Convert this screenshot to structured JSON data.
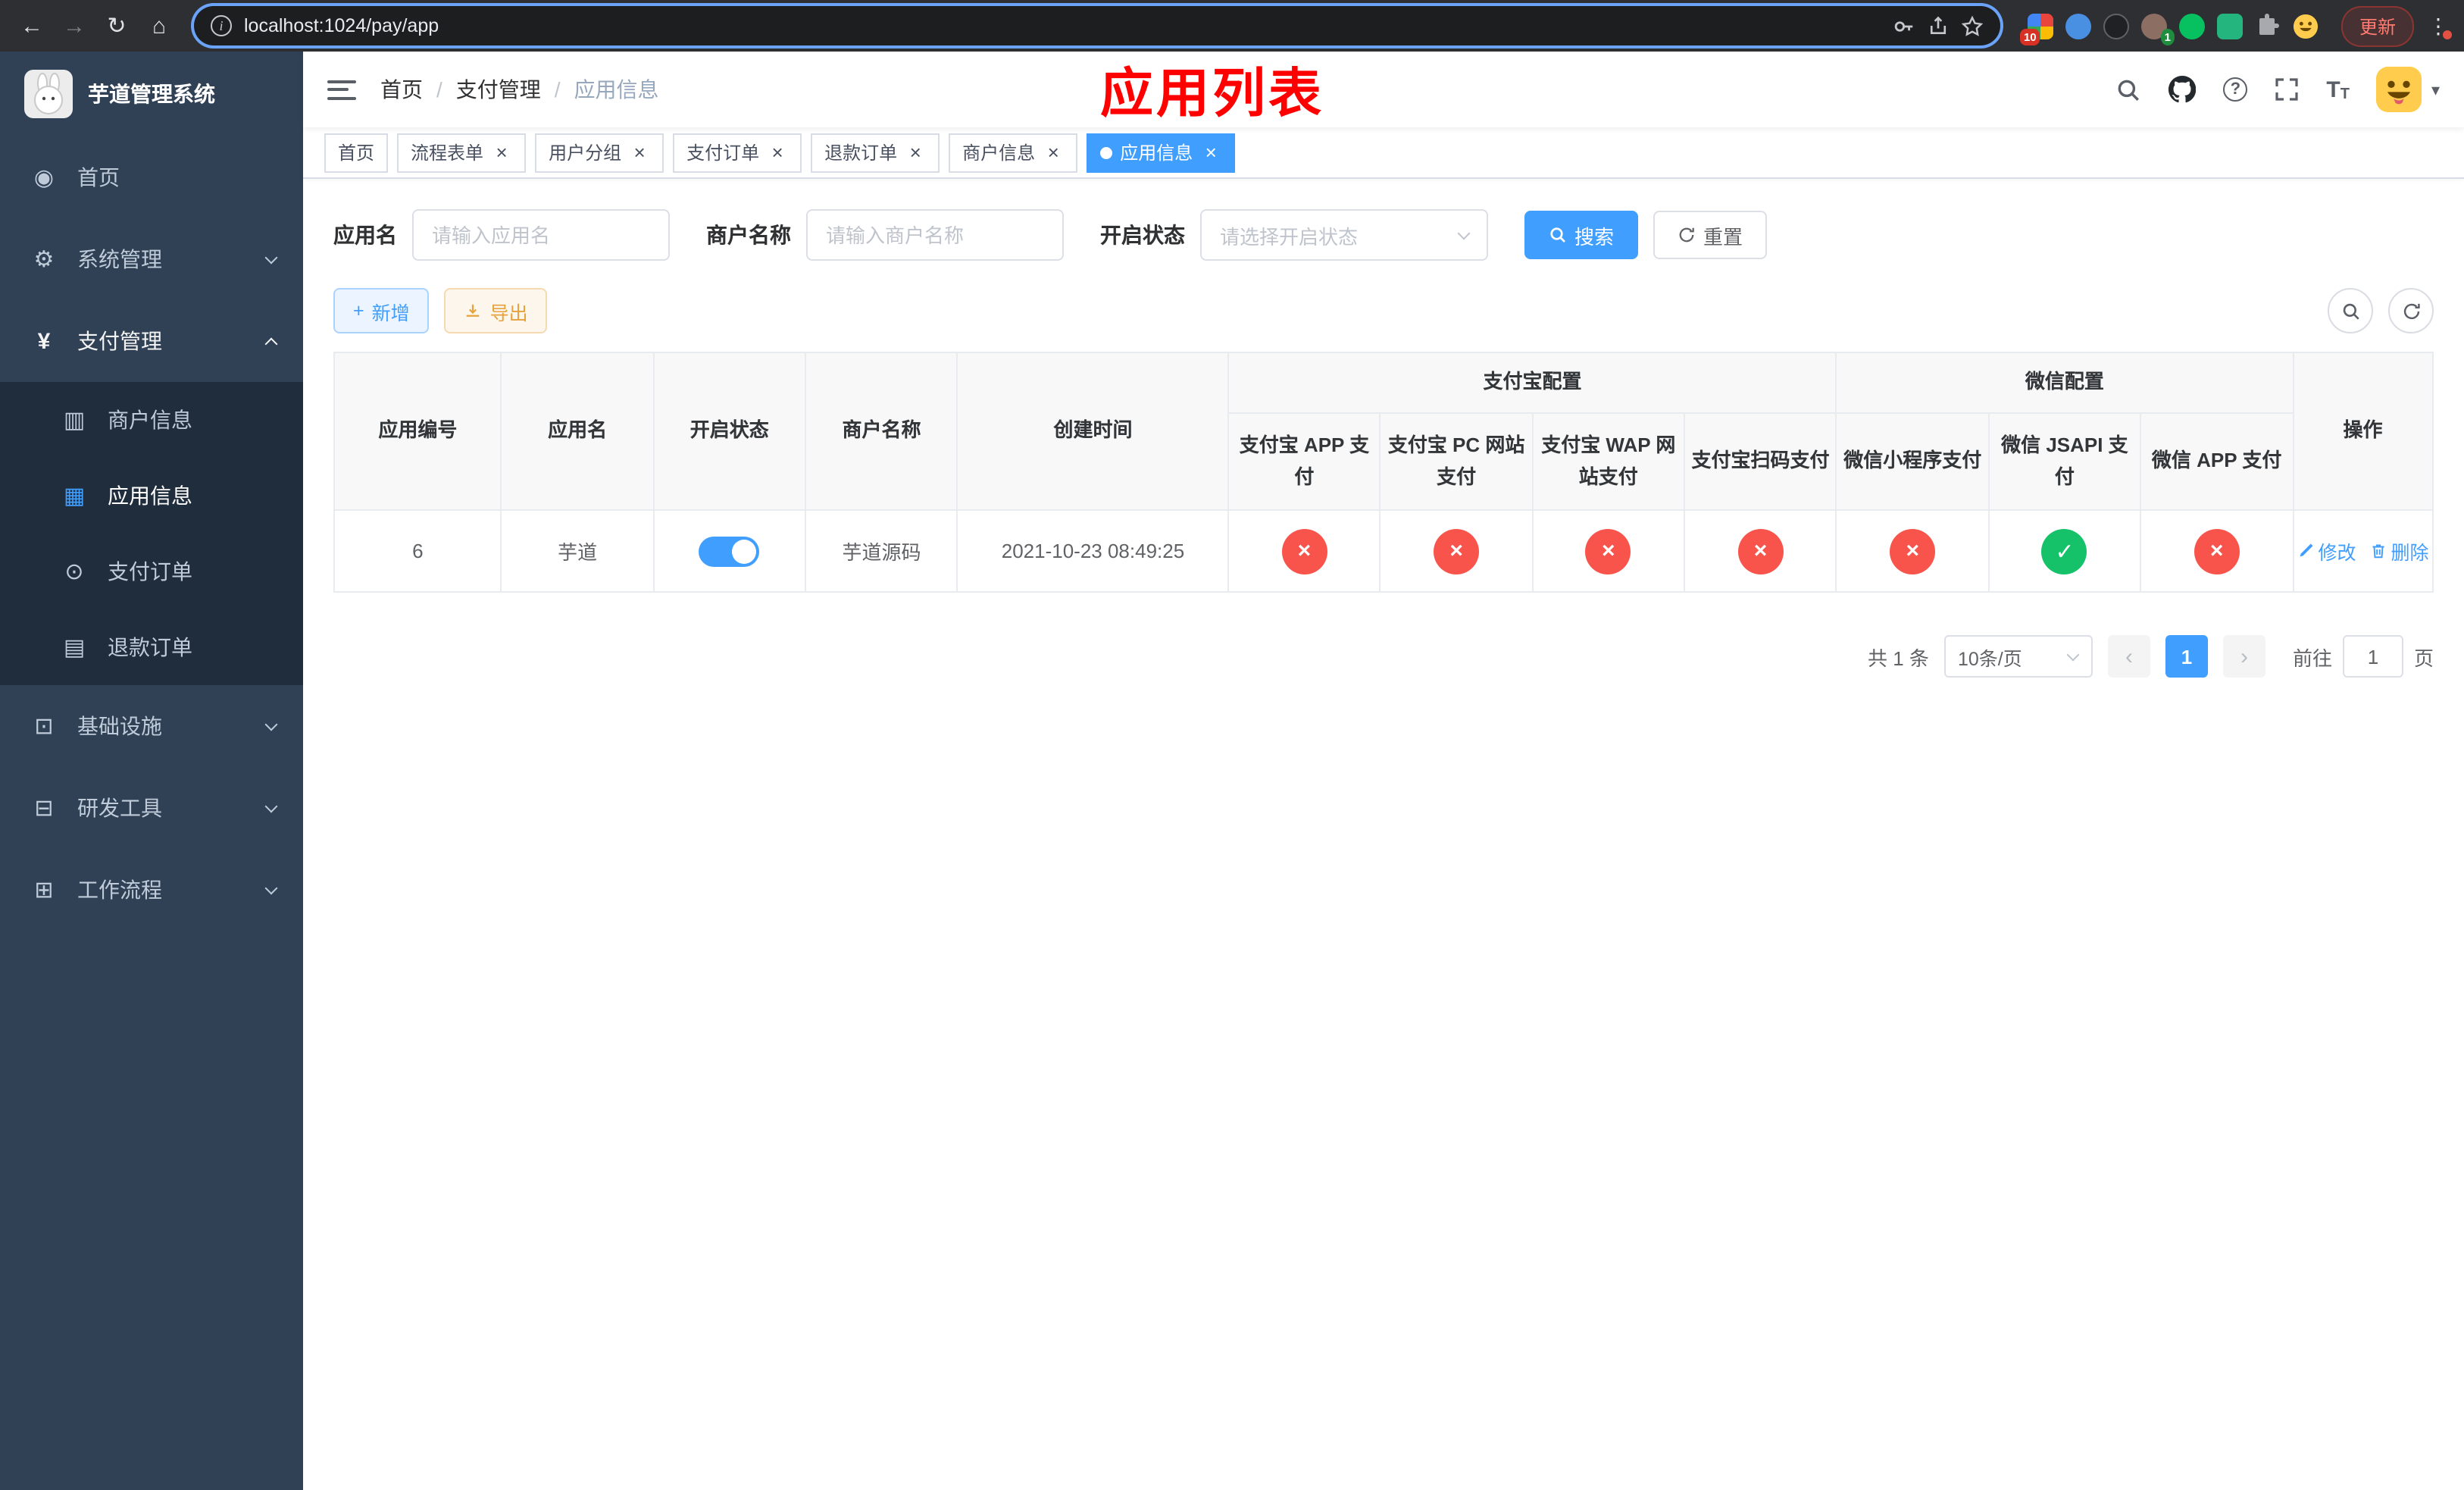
{
  "colors": {
    "primary": "#409eff",
    "danger": "#f8544b",
    "success": "#16c269",
    "warning": "#e6a23c",
    "annotation_red": "#fe0000",
    "sidebar_bg": "#304156",
    "submenu_bg": "#1f2d3d"
  },
  "icons": {
    "back": "←",
    "forward": "→",
    "reload": "↻",
    "home": "⌂",
    "kebab": "⋮",
    "caret_down": "▾",
    "close": "×",
    "check": "✓",
    "cross": "×",
    "dashboard": "◉",
    "gear": "⚙",
    "yen": "¥",
    "merchant_card": "▥",
    "app_grid": "▦",
    "pay_order": "⊙",
    "refund_doc": "▤",
    "infra": "⊡",
    "devtools": "⊟",
    "workflow": "⊞",
    "plus": "+"
  },
  "browser": {
    "url": "localhost:1024/pay/app",
    "update_label": "更新",
    "ext_badge_blocker": "10",
    "ext_badge_profile": "1"
  },
  "sidebar": {
    "title": "芋道管理系统",
    "menu": [
      {
        "label": "首页"
      },
      {
        "label": "系统管理"
      },
      {
        "label": "支付管理"
      },
      {
        "label": "基础设施"
      },
      {
        "label": "研发工具"
      },
      {
        "label": "工作流程"
      }
    ],
    "payment_children": [
      {
        "label": "商户信息"
      },
      {
        "label": "应用信息"
      },
      {
        "label": "支付订单"
      },
      {
        "label": "退款订单"
      }
    ]
  },
  "navbar": {
    "breadcrumb": [
      {
        "label": "首页"
      },
      {
        "label": "支付管理"
      },
      {
        "label": "应用信息"
      }
    ],
    "annotation": "应用列表"
  },
  "tabs": [
    {
      "label": "首页"
    },
    {
      "label": "流程表单"
    },
    {
      "label": "用户分组"
    },
    {
      "label": "支付订单"
    },
    {
      "label": "退款订单"
    },
    {
      "label": "商户信息"
    },
    {
      "label": "应用信息"
    }
  ],
  "filters": {
    "app_name_label": "应用名",
    "app_name_placeholder": "请输入应用名",
    "merchant_label": "商户名称",
    "merchant_placeholder": "请输入商户名称",
    "status_label": "开启状态",
    "status_placeholder": "请选择开启状态",
    "search_label": "搜索",
    "reset_label": "重置"
  },
  "toolbar": {
    "add_label": "新增",
    "export_label": "导出"
  },
  "table": {
    "col_app_id": "应用编号",
    "col_app_name": "应用名",
    "col_status": "开启状态",
    "col_merchant": "商户名称",
    "col_created": "创建时间",
    "group_alipay": "支付宝配置",
    "group_wechat": "微信配置",
    "col_alipay_app": "支付宝 APP 支付",
    "col_alipay_pc": "支付宝 PC 网站支付",
    "col_alipay_wap": "支付宝 WAP 网站支付",
    "col_alipay_qr": "支付宝扫码支付",
    "col_wechat_lite": "微信小程序支付",
    "col_wechat_jsapi": "微信 JSAPI 支付",
    "col_wechat_app": "微信 APP 支付",
    "col_actions": "操作",
    "row": {
      "id": "6",
      "name": "芋道",
      "enabled": true,
      "merchant": "芋道源码",
      "created_at": "2021-10-23 08:49:25",
      "config": [
        "no",
        "no",
        "no",
        "no",
        "no",
        "yes",
        "no"
      ],
      "edit_label": "修改",
      "delete_label": "删除"
    }
  },
  "pagination": {
    "total": "共 1 条",
    "page_size": "10条/页",
    "page": "1",
    "goto_prefix": "前往",
    "goto_value": "1",
    "goto_suffix": "页"
  }
}
